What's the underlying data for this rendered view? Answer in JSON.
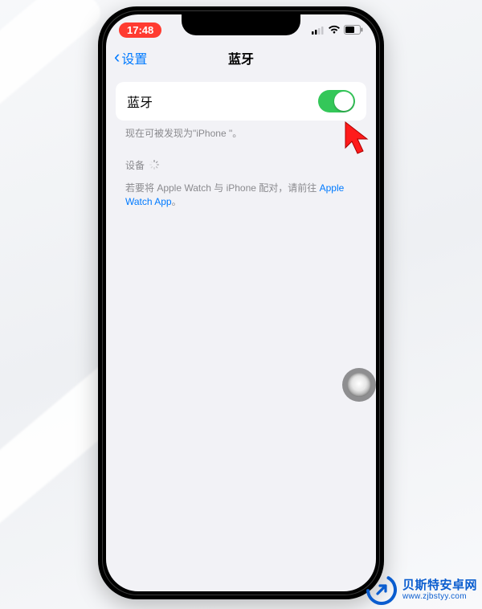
{
  "status": {
    "time": "17:48"
  },
  "nav": {
    "back_label": "设置",
    "title": "蓝牙"
  },
  "bluetooth": {
    "row_label": "蓝牙",
    "enabled": true,
    "discoverable_text": "现在可被发现为\"iPhone \"。"
  },
  "devices": {
    "header": "设备",
    "pair_hint_prefix": "若要将 Apple Watch 与 iPhone 配对，请前往 ",
    "pair_hint_link": "Apple Watch App",
    "pair_hint_suffix": "。"
  },
  "watermark": {
    "main": "贝斯特安卓网",
    "sub": "www.zjbstyy.com"
  },
  "colors": {
    "accent_blue": "#007aff",
    "toggle_green": "#34c759",
    "time_pill_red": "#ff3b30",
    "wm_blue": "#0a5dcf"
  }
}
